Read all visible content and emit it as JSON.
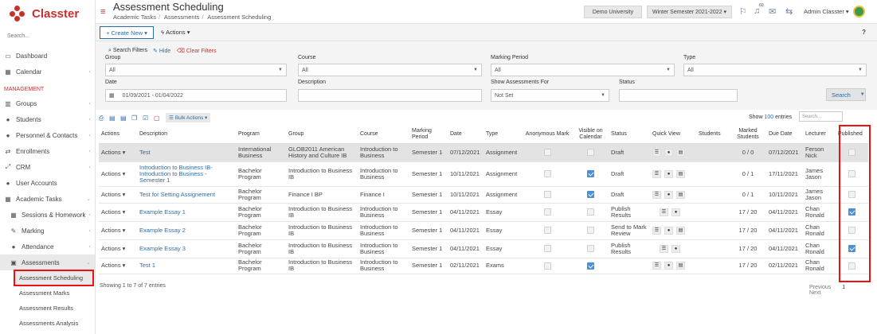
{
  "app": {
    "name": "Classter"
  },
  "sidebar": {
    "search_placeholder": "Search...",
    "items": [
      {
        "label": "Dashboard",
        "icon": "laptop-icon"
      },
      {
        "label": "Calendar",
        "icon": "calendar-icon"
      }
    ],
    "section": "MANAGEMENT",
    "mgmt_items": [
      {
        "label": "Groups",
        "icon": "groups-icon"
      },
      {
        "label": "Students",
        "icon": "students-icon"
      },
      {
        "label": "Personnel & Contacts",
        "icon": "personnel-icon"
      },
      {
        "label": "Enrollments",
        "icon": "enrollments-icon"
      },
      {
        "label": "CRM",
        "icon": "crm-icon"
      },
      {
        "label": "User Accounts",
        "icon": "user-icon"
      },
      {
        "label": "Academic Tasks",
        "icon": "grid-icon"
      }
    ],
    "academic_sub": [
      {
        "label": "Sessions & Homework",
        "icon": "sessions-icon"
      },
      {
        "label": "Marking",
        "icon": "pencil-icon"
      },
      {
        "label": "Attendance",
        "icon": "attendance-icon"
      },
      {
        "label": "Assessments",
        "icon": "assessment-icon"
      }
    ],
    "assessment_sub": [
      "Assessment Scheduling",
      "Assessment Marks",
      "Assessment Results",
      "Assessments Analysis"
    ]
  },
  "header": {
    "title": "Assessment Scheduling",
    "breadcrumbs": [
      "Academic Tasks",
      "Assessments",
      "Assessment Scheduling"
    ],
    "university": "Demo University",
    "semester": "Winter Semester 2021-2022 ▾",
    "badge_count": "60",
    "user": "Admin Classter ▾"
  },
  "toolbar": {
    "create_new": "Create New ▾",
    "actions": "Actions ▾",
    "help": "?"
  },
  "filters": {
    "search_filters": "Search Filters",
    "hide": "Hide",
    "clear": "Clear Filters",
    "group": {
      "label": "Group",
      "value": "All"
    },
    "course": {
      "label": "Course",
      "value": "All"
    },
    "marking_period": {
      "label": "Marking Period",
      "value": "All"
    },
    "type": {
      "label": "Type",
      "value": "All"
    },
    "date": {
      "label": "Date",
      "value": "01/09/2021 - 01/04/2022"
    },
    "description": {
      "label": "Description",
      "value": ""
    },
    "show_for": {
      "label": "Show Assessments For",
      "value": "Not Set"
    },
    "status": {
      "label": "Status",
      "value": ""
    },
    "search_button": "Search"
  },
  "table_tools": {
    "bulk_actions": "Bulk Actions ▾",
    "show": "Show",
    "entries_count": "100",
    "entries": "entries",
    "search_placeholder": "Search..."
  },
  "table": {
    "headers": [
      "Actions",
      "Description",
      "Program",
      "Group",
      "Course",
      "Marking Period",
      "Date",
      "Type",
      "Anonymous Mark",
      "Visible on Calendar",
      "Status",
      "Quick View",
      "Students",
      "Marked Students",
      "Due Date",
      "Lecturer",
      "Published"
    ],
    "action_label": "Actions ▾",
    "rows": [
      {
        "description": "Test",
        "program": "International Business",
        "group": "GLOB2011 American History and Culture IB",
        "course": "Introduction to Business",
        "period": "Semester 1",
        "date": "07/12/2021",
        "type": "Assignment",
        "anonymous": false,
        "visible": false,
        "status": "Draft",
        "quick": 3,
        "marked": "0 / 0",
        "due": "07/12/2021",
        "lecturer": "Ferson Nick",
        "published": false
      },
      {
        "description": "Introduction to Business IB- Introduction to Business - Semester 1",
        "program": "Bachelor Program",
        "group": "Introduction to Business IB",
        "course": "Introduction to Business",
        "period": "Semester 1",
        "date": "10/11/2021",
        "type": "Assignment",
        "anonymous": false,
        "visible": true,
        "status": "Draft",
        "quick": 3,
        "marked": "0 / 1",
        "due": "17/11/2021",
        "lecturer": "James Jason",
        "published": false
      },
      {
        "description": "Test for Setting Assignement",
        "program": "Bachelor Program",
        "group": "Finance I BP",
        "course": "Finance I",
        "period": "Semester 1",
        "date": "10/11/2021",
        "type": "Assignment",
        "anonymous": false,
        "visible": true,
        "status": "Draft",
        "quick": 3,
        "marked": "0 / 1",
        "due": "10/11/2021",
        "lecturer": "James Jason",
        "published": false
      },
      {
        "description": "Example Essay 1",
        "program": "Bachelor Program",
        "group": "Introduction to Business IB",
        "course": "Introduction to Business",
        "period": "Semester 1",
        "date": "04/11/2021",
        "type": "Essay",
        "anonymous": false,
        "visible": false,
        "status": "Publish Results",
        "quick": 2,
        "marked": "17 / 20",
        "due": "04/11/2021",
        "lecturer": "Chan Ronald",
        "published": true
      },
      {
        "description": "Example Essay 2",
        "program": "Bachelor Program",
        "group": "Introduction to Business IB",
        "course": "Introduction to Business",
        "period": "Semester 1",
        "date": "04/11/2021",
        "type": "Essay",
        "anonymous": false,
        "visible": false,
        "status": "Send to Mark Review",
        "quick": 3,
        "marked": "17 / 20",
        "due": "04/11/2021",
        "lecturer": "Chan Ronald",
        "published": false
      },
      {
        "description": "Example Essay 3",
        "program": "Bachelor Program",
        "group": "Introduction to Business IB",
        "course": "Introduction to Business",
        "period": "Semester 1",
        "date": "04/11/2021",
        "type": "Essay",
        "anonymous": false,
        "visible": false,
        "status": "Publish Results",
        "quick": 2,
        "marked": "17 / 20",
        "due": "04/11/2021",
        "lecturer": "Chan Ronald",
        "published": true
      },
      {
        "description": "Test 1",
        "program": "Bachelor Program",
        "group": "Introduction to Business IB",
        "course": "Introduction to Business",
        "period": "Semester 1",
        "date": "02/11/2021",
        "type": "Exams",
        "anonymous": false,
        "visible": true,
        "status": "",
        "quick": 3,
        "marked": "17 / 20",
        "due": "02/11/2021",
        "lecturer": "Chan Ronald",
        "published": false
      }
    ]
  },
  "footer": {
    "info": "Showing 1 to 7 of 7 entries",
    "previous": "Previous",
    "page": "1",
    "next": "Next"
  }
}
